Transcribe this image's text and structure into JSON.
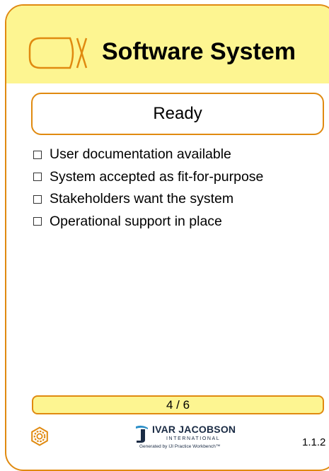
{
  "card": {
    "title": "Software System",
    "state": "Ready",
    "checklist": [
      "User documentation available",
      "System accepted as fit-for-purpose",
      "Stakeholders want the system",
      "Operational support in place"
    ],
    "page_indicator": "4 / 6",
    "version": "1.1.2",
    "icons": {
      "header": "alpha-icon",
      "footer": "gear-icon",
      "logo": "ivar-jacobson-logo-icon"
    },
    "colors": {
      "border": "#e08a10",
      "header_fill": "#fdf591",
      "logo_blue": "#1a2b44",
      "logo_accent": "#2b8fc8"
    }
  },
  "logo": {
    "name": "IVAR JACOBSON",
    "subtitle": "INTERNATIONAL",
    "generated_by": "Generated by IJI Practice Workbench™"
  }
}
